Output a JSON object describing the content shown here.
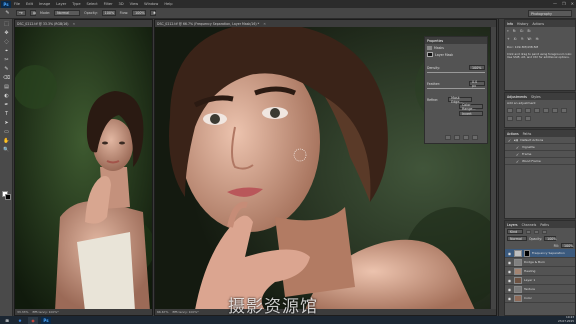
{
  "app": {
    "logo": "Ps"
  },
  "menu": [
    "File",
    "Edit",
    "Image",
    "Layer",
    "Type",
    "Select",
    "Filter",
    "3D",
    "View",
    "Window",
    "Help"
  ],
  "window_controls": [
    "—",
    "❐",
    "✕"
  ],
  "options": {
    "mode_label": "Mode:",
    "mode_value": "Normal",
    "opacity_label": "Opacity:",
    "opacity_value": "100%",
    "flow_label": "Flow:",
    "flow_value": "100%"
  },
  "workspace": "Photography",
  "tools": [
    "⬚",
    "✥",
    "◌",
    "⌖",
    "✂",
    "✎",
    "⌫",
    "▤",
    "◐",
    "✒",
    "T",
    "➤",
    "▭",
    "✋",
    "🔍"
  ],
  "doc_left": {
    "tab": "DSC_0212.tif @ 33.3% (RGB/16)",
    "zoom": "33.33%",
    "info": "Efficiency: 100%*"
  },
  "doc_main": {
    "tab": "DSC_0212.tif @ 66.7% (Frequency Separation, Layer Mask/16) *",
    "zoom": "66.67%",
    "info": "Efficiency: 100%*"
  },
  "properties": {
    "tab": "Properties",
    "section": "Masks",
    "mask_label": "Layer Mask",
    "density_label": "Density:",
    "density_value": "100%",
    "feather_label": "Feather:",
    "feather_value": "0.0 px",
    "refine_label": "Refine:",
    "btn_mask_edge": "Mask Edge...",
    "btn_color_range": "Color Range...",
    "btn_invert": "Invert"
  },
  "history": {
    "tabs": [
      "Info",
      "History",
      "Actions"
    ],
    "note": "Doc: 109.3M/438.5M",
    "hint": "Click and drag to paint using foreground color. Use Shift, Alt, and Ctrl for additional options."
  },
  "adjustments": {
    "tabs": [
      "Adjustments",
      "Styles"
    ],
    "label": "Add an adjustment"
  },
  "actions": {
    "tabs": [
      "Actions",
      "Paths"
    ],
    "items": [
      "Default Actions",
      "Vignette",
      "Frame",
      "Wood Frame"
    ]
  },
  "layers": {
    "tabs": [
      "Layers",
      "Channels",
      "Paths"
    ],
    "kind_label": "Kind",
    "blend": "Normal",
    "opacity_label": "Opacity:",
    "opacity_value": "100%",
    "fill_label": "Fill:",
    "fill_value": "100%",
    "items": [
      {
        "name": "Frequency Separation",
        "active": true
      },
      {
        "name": "Dodge & Burn",
        "active": false
      },
      {
        "name": "Healing",
        "active": false
      },
      {
        "name": "Layer 1",
        "active": false
      },
      {
        "name": "Texture",
        "active": false
      },
      {
        "name": "Color",
        "active": false
      },
      {
        "name": "Background",
        "active": false
      }
    ]
  },
  "watermark": "摄影资源馆",
  "taskbar": {
    "items": [
      "⊞",
      "e",
      "◉",
      "Ps"
    ],
    "time": "10:23",
    "date": "23.07.2015"
  },
  "colors": {
    "accent": "#1473e6",
    "bg": "#3a3a3a",
    "panel": "#535353"
  },
  "icons": [
    "move-icon",
    "marquee-icon",
    "lasso-icon",
    "crop-icon",
    "brush-icon",
    "eraser-icon",
    "eye-icon",
    "mask-icon",
    "folder-icon"
  ]
}
